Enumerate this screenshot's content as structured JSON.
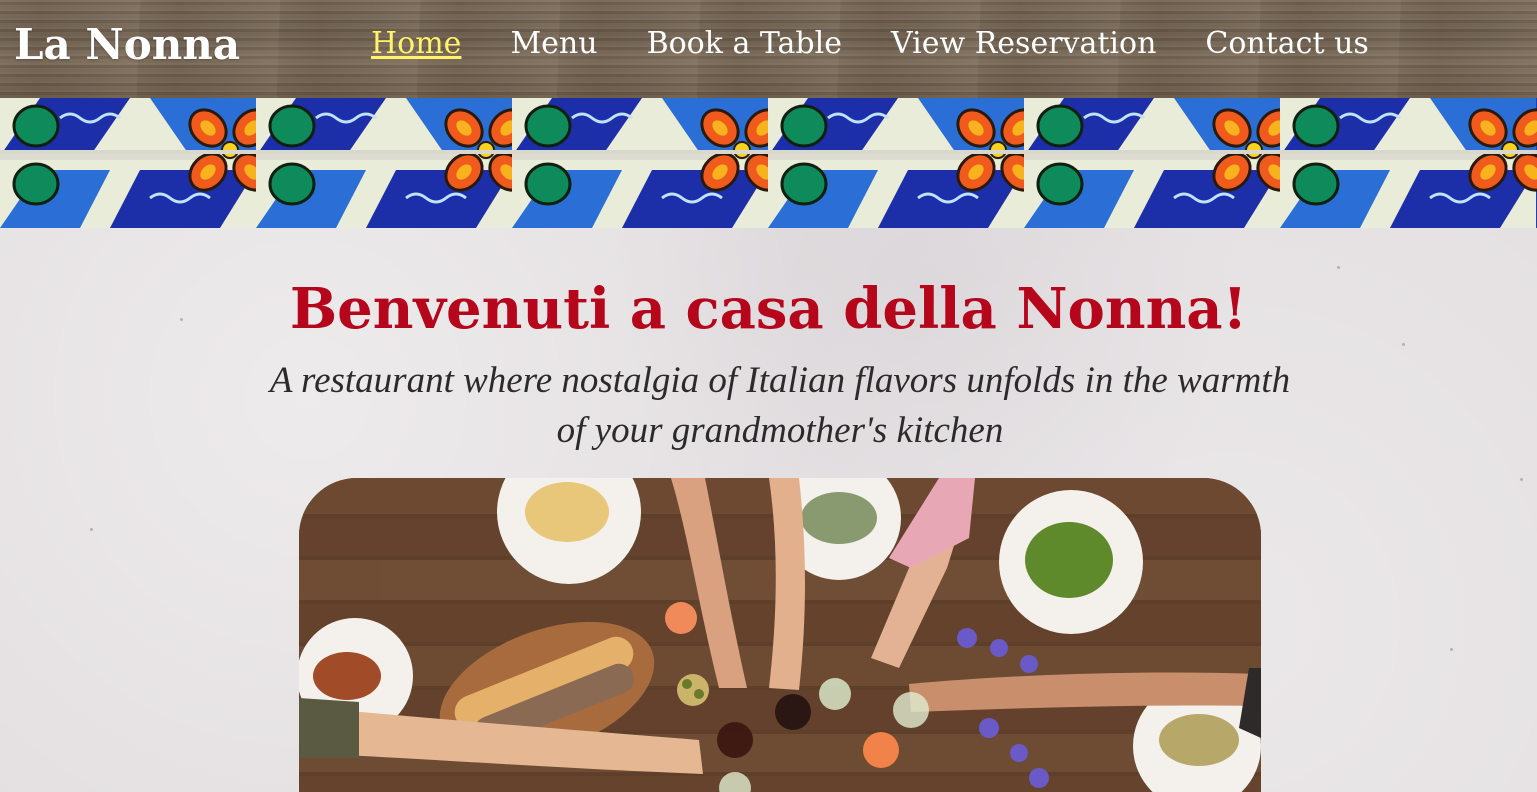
{
  "header": {
    "brand": "La Nonna",
    "nav": [
      {
        "label": "Home",
        "active": true
      },
      {
        "label": "Menu",
        "active": false
      },
      {
        "label": "Book a Table",
        "active": false
      },
      {
        "label": "View Reservation",
        "active": false
      },
      {
        "label": "Contact us",
        "active": false
      }
    ]
  },
  "hero": {
    "headline": "Benvenuti a casa della Nonna!",
    "tagline": "A restaurant where nostalgia of Italian flavors unfolds in the warmth of your grandmother's kitchen"
  },
  "colors": {
    "headline": "#b5061c",
    "nav_active": "#fff36a",
    "nav_text": "#ffffff"
  },
  "images": {
    "banner": "decorative-tile-pattern",
    "photo": "dinner-table-toast-photo"
  }
}
